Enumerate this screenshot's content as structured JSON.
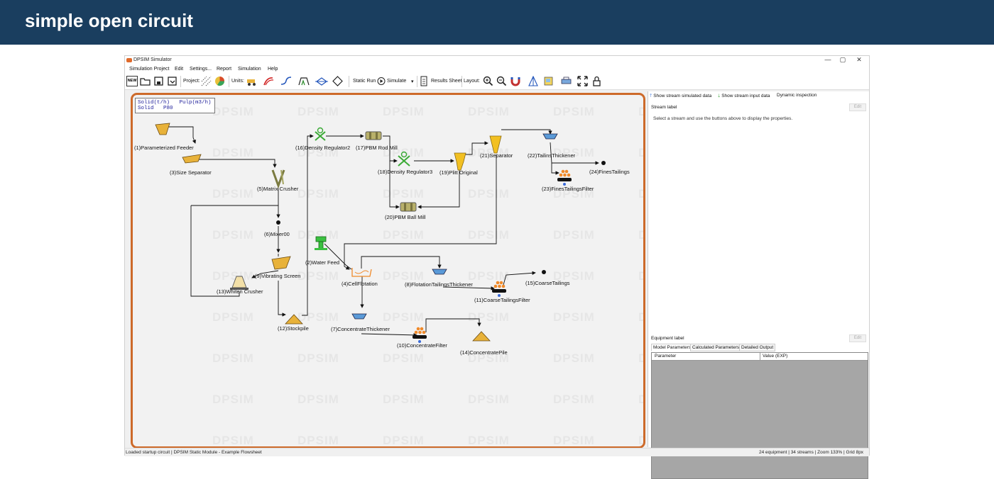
{
  "slide": {
    "title": "simple open circuit"
  },
  "window": {
    "title": "DPSIM Simulator",
    "controls": [
      "—",
      "▢",
      "✕"
    ]
  },
  "menu": [
    "Simulation Project",
    "Edit",
    "Settings...",
    "Report",
    "Simulation",
    "Help"
  ],
  "toolbar": {
    "new_label": "NEW",
    "project_label": "Project:",
    "units_label": "Units:",
    "static_run": "Static Run",
    "simulate": "Simulate",
    "results_sheet": "Results Sheet",
    "layout_label": "Layout:"
  },
  "canvas": {
    "watermark": "DPSIM",
    "units_box": "Solid(t/h)   Pulp(m3/h)\nSolid   P80",
    "units": [
      "(1)Parameterized Feeder",
      "(2)Water Feed",
      "(3)Size Separator",
      "(4)CellFlotation",
      "(5)Matrix Crusher",
      "(6)Mixer00",
      "(7)ConcentrateThickener",
      "(8)FlotationTailingsThickener",
      "(9)Vibrating Screen",
      "(10)ConcentrateFilter",
      "(11)CoarseTailingsFilter",
      "(12)Stockpile",
      "(13)Whiten Crusher",
      "(14)ConcentratePile",
      "(15)CoarseTailings",
      "(16)Density Regulator2",
      "(17)PBM Rod Mill",
      "(18)Density Regulator3",
      "(19)Plitt Original",
      "(20)PBM Ball Mill",
      "(21)Separator",
      "(22)TailinsThickener",
      "(23)FinesTailingsFilter",
      "(24)FinesTailings"
    ]
  },
  "right_panel": {
    "show_simulated": "Show stream simulated data",
    "show_input": "Show stream input data",
    "dynamic": "Dynamic inspection",
    "stream_label": "Stream label",
    "edit": "Edit",
    "message": "Select a stream and use the buttons above to display the properties.",
    "equipment_label": "Equipment label",
    "tabs": [
      "Model Parameters",
      "Calculated Parameters",
      "Detailed Output"
    ],
    "columns": [
      "Parameter",
      "Value (EXP)"
    ]
  },
  "status": {
    "left": "Loaded startup circuit | DPSIM Static Module - Example Flowsheet",
    "right": "24 equipment | 34 streams | Zoom 133% | Grid 8px"
  },
  "colors": {
    "banner": "#1a3e5f",
    "canvas_border": "#cd6a2a",
    "feeder": "#e8b23a",
    "valve": "#3aaa35"
  }
}
